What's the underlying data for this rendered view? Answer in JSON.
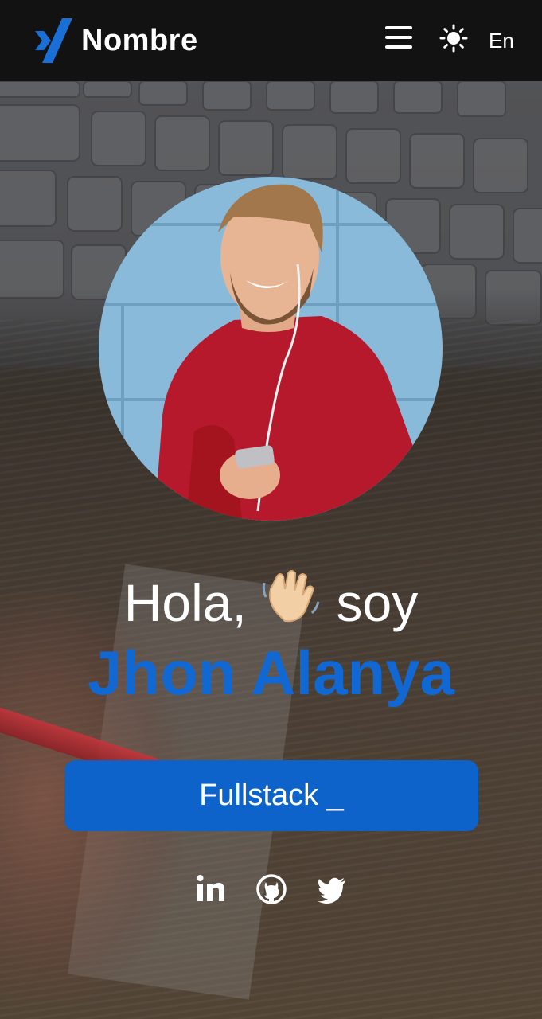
{
  "header": {
    "logo_icon": "x-logo-icon",
    "brand_name": "Nombre",
    "menu_icon": "hamburger-menu-icon",
    "theme_icon": "sun-icon",
    "language": "En"
  },
  "hero": {
    "greeting_before": "Hola,",
    "greeting_emoji": "waving-hand-icon",
    "greeting_after": "soy",
    "name": "Jhon Alanya",
    "role_button": "Fullstack _",
    "avatar": "profile-photo"
  },
  "socials": [
    {
      "icon": "linkedin-icon"
    },
    {
      "icon": "github-icon"
    },
    {
      "icon": "twitter-icon"
    }
  ],
  "colors": {
    "header_bg": "#121212",
    "accent": "#0d63c9",
    "name_color": "#1168d2",
    "text": "#ffffff"
  }
}
